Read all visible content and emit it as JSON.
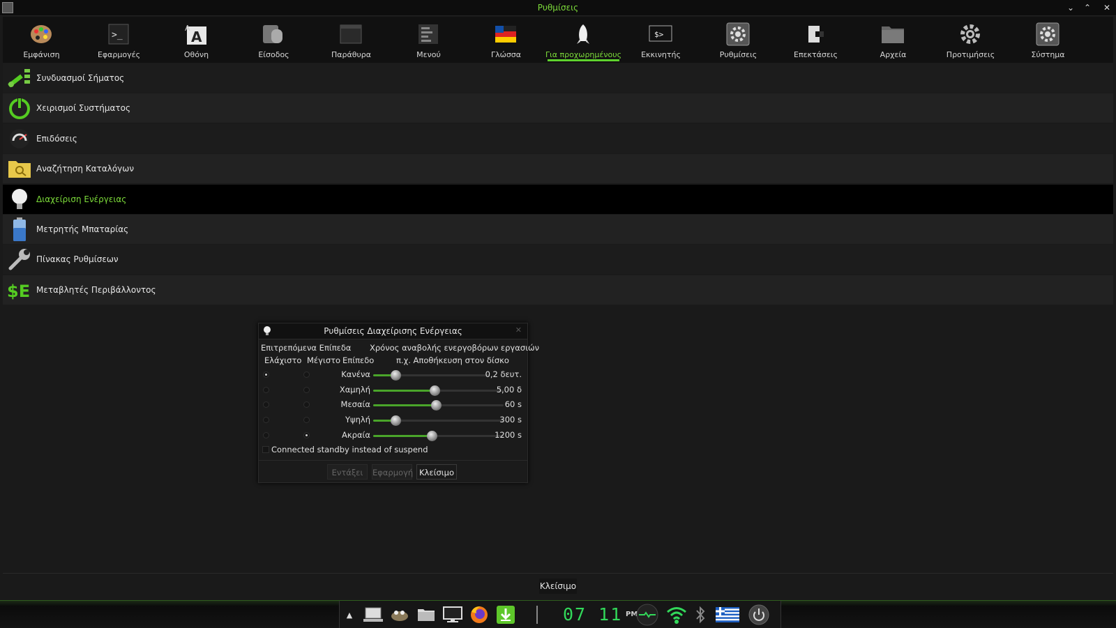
{
  "window": {
    "title": "Ρυθμίσεις"
  },
  "toolbar": {
    "items": [
      {
        "label": "Εμφάνιση",
        "icon": "palette-icon"
      },
      {
        "label": "Εφαρμογές",
        "icon": "terminal-icon"
      },
      {
        "label": "Οθόνη",
        "icon": "font-icon"
      },
      {
        "label": "Είσοδος",
        "icon": "mouse-icon"
      },
      {
        "label": "Παράθυρα",
        "icon": "window-icon"
      },
      {
        "label": "Μενού",
        "icon": "menu-icon"
      },
      {
        "label": "Γλώσσα",
        "icon": "flag-icon"
      },
      {
        "label": "Για προχωρημένους",
        "icon": "rocket-icon"
      },
      {
        "label": "Εκκινητής",
        "icon": "launcher-icon"
      },
      {
        "label": "Ρυθμίσεις",
        "icon": "settings-icon"
      },
      {
        "label": "Επεκτάσεις",
        "icon": "plugin-icon"
      },
      {
        "label": "Αρχεία",
        "icon": "folder-icon"
      },
      {
        "label": "Προτιμήσεις",
        "icon": "gear-icon"
      },
      {
        "label": "Σύστημα",
        "icon": "system-icon"
      }
    ],
    "active_index": 7
  },
  "list": {
    "items": [
      {
        "label": "Συνδυασμοί Σήματος"
      },
      {
        "label": "Χειρισμοί Συστήματος"
      },
      {
        "label": "Επιδόσεις"
      },
      {
        "label": "Αναζήτηση Καταλόγων"
      },
      {
        "label": "Διαχείριση Ενέργειας"
      },
      {
        "label": "Μετρητής Μπαταρίας"
      },
      {
        "label": "Πίνακας Ρυθμίσεων"
      },
      {
        "label": "Μεταβλητές Περιβάλλοντος"
      }
    ],
    "selected_index": 4,
    "selected_color": "#7ddc3a"
  },
  "dialog": {
    "title": "Ρυθμίσεις Διαχείρισης Ενέργειας",
    "header_allowed": "Επιτρεπόμενα Επίπεδα",
    "header_delay": "Χρόνος αναβολής ενεργοβόρων εργασιών",
    "col_min": "Ελάχιστο",
    "col_max": "Μέγιστο",
    "col_level": "Επίπεδο",
    "col_example": "π.χ. Αποθήκευση στον δίσκο",
    "levels": [
      {
        "name": "Κανένα",
        "value": "0,2 δευτ.",
        "min_selected": true,
        "max_selected": false,
        "position": 0.19
      },
      {
        "name": "Χαμηλή",
        "value": "5,00 δ",
        "min_selected": false,
        "max_selected": false,
        "position": 0.47
      },
      {
        "name": "Μεσαία",
        "value": "60 s",
        "min_selected": false,
        "max_selected": false,
        "position": 0.48
      },
      {
        "name": "Υψηλή",
        "value": "300 s",
        "min_selected": false,
        "max_selected": false,
        "position": 0.17
      },
      {
        "name": "Ακραία",
        "value": "1200 s",
        "min_selected": false,
        "max_selected": true,
        "position": 0.45
      }
    ],
    "standby_label": "Connected standby instead of suspend",
    "standby_checked": false,
    "buttons": {
      "ok": "Εντάξει",
      "apply": "Εφαρμογή",
      "close": "Κλείσιμο"
    }
  },
  "footer": {
    "close": "Κλείσιμο"
  },
  "taskbar": {
    "clock_hours": "07",
    "clock_minutes": "11",
    "ampm": "PM",
    "accent": "#32d95a"
  }
}
